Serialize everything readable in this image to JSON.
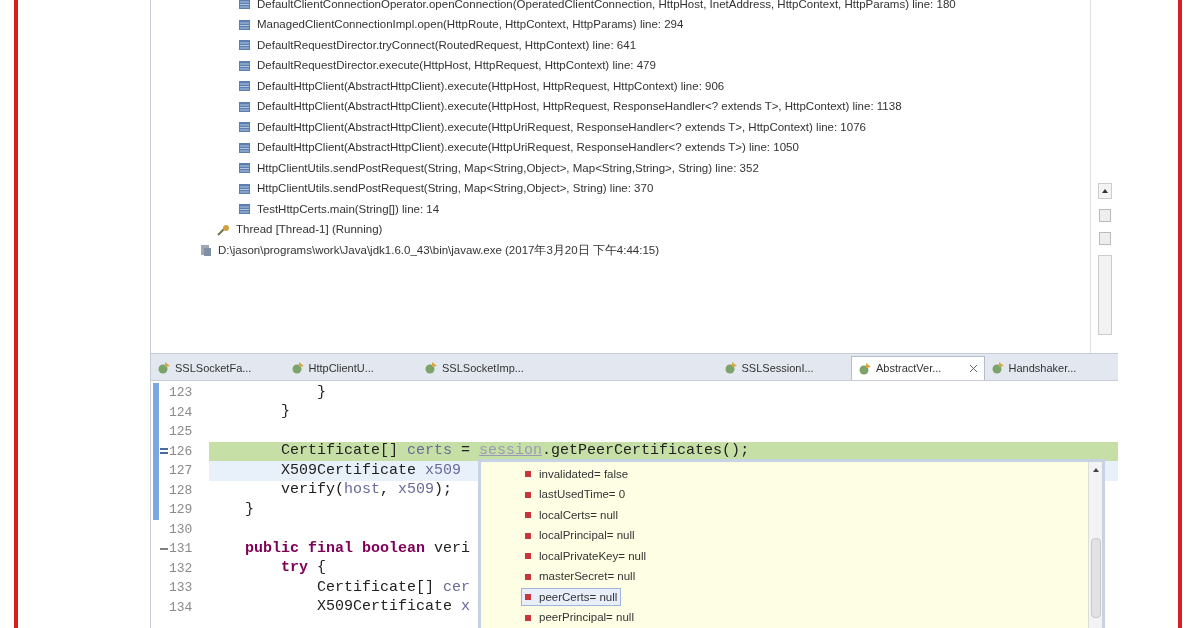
{
  "debug_view": {
    "frames": [
      {
        "label": "DefaultClientConnectionOperator.openConnection(OperatedClientConnection, HttpHost, InetAddress, HttpContext, HttpParams) line: 180"
      },
      {
        "label": "ManagedClientConnectionImpl.open(HttpRoute, HttpContext, HttpParams) line: 294"
      },
      {
        "label": "DefaultRequestDirector.tryConnect(RoutedRequest, HttpContext) line: 641"
      },
      {
        "label": "DefaultRequestDirector.execute(HttpHost, HttpRequest, HttpContext) line: 479"
      },
      {
        "label": "DefaultHttpClient(AbstractHttpClient).execute(HttpHost, HttpRequest, HttpContext) line: 906"
      },
      {
        "label": "DefaultHttpClient(AbstractHttpClient).execute(HttpHost, HttpRequest, ResponseHandler<? extends T>, HttpContext) line: 1138"
      },
      {
        "label": "DefaultHttpClient(AbstractHttpClient).execute(HttpUriRequest, ResponseHandler<? extends T>, HttpContext) line: 1076"
      },
      {
        "label": "DefaultHttpClient(AbstractHttpClient).execute(HttpUriRequest, ResponseHandler<? extends T>) line: 1050"
      },
      {
        "label": "HttpClientUtils.sendPostRequest(String, Map<String,Object>, Map<String,String>, String) line: 352"
      },
      {
        "label": "HttpClientUtils.sendPostRequest(String, Map<String,Object>, String) line: 370"
      },
      {
        "label": "TestHttpCerts.main(String[]) line: 14"
      }
    ],
    "thread": {
      "label": "Thread [Thread-1] (Running)"
    },
    "process": {
      "label": "D:\\jason\\programs\\work\\Java\\jdk1.6.0_43\\bin\\javaw.exe (2017年3月20日 下午4:44:15)"
    }
  },
  "editor_tabs": [
    {
      "label": "SSLSocketFa...",
      "selected": false
    },
    {
      "label": "HttpClientU...",
      "selected": false
    },
    {
      "label": "SSLSocketImp...",
      "selected": false
    },
    {
      "label": "SSLSessionI...",
      "selected": false
    },
    {
      "label": "AbstractVer...",
      "selected": true
    },
    {
      "label": "Handshaker...",
      "selected": false
    }
  ],
  "code_lines": [
    {
      "number": "123",
      "marked": true,
      "current": false,
      "cursor": false,
      "pointer": false,
      "fold": false,
      "tokens": [
        {
          "text": "            }",
          "kind": "plain"
        }
      ]
    },
    {
      "number": "124",
      "marked": true,
      "current": false,
      "cursor": false,
      "pointer": false,
      "fold": false,
      "tokens": [
        {
          "text": "        }",
          "kind": "plain"
        }
      ]
    },
    {
      "number": "125",
      "marked": true,
      "current": false,
      "cursor": false,
      "pointer": false,
      "fold": false
    },
    {
      "number": "126",
      "marked": true,
      "current": true,
      "cursor": false,
      "pointer": true,
      "fold": false,
      "tokens": [
        {
          "text": "        Certificate[] ",
          "kind": "plain"
        },
        {
          "text": "certs",
          "kind": "local"
        },
        {
          "text": " = ",
          "kind": "plain"
        },
        {
          "text": "session",
          "kind": "field"
        },
        {
          "text": ".getPeerCertificates();",
          "kind": "plain"
        }
      ]
    },
    {
      "number": "127",
      "marked": true,
      "current": false,
      "cursor": true,
      "pointer": false,
      "fold": false,
      "tokens": [
        {
          "text": "        X509Certificate ",
          "kind": "plain"
        },
        {
          "text": "x509",
          "kind": "local"
        }
      ]
    },
    {
      "number": "128",
      "marked": true,
      "current": false,
      "cursor": false,
      "pointer": false,
      "fold": false,
      "tokens": [
        {
          "text": "        verify(",
          "kind": "plain"
        },
        {
          "text": "host",
          "kind": "local"
        },
        {
          "text": ", ",
          "kind": "plain"
        },
        {
          "text": "x509",
          "kind": "local"
        },
        {
          "text": ");",
          "kind": "plain"
        }
      ]
    },
    {
      "number": "129",
      "marked": true,
      "current": false,
      "cursor": false,
      "pointer": false,
      "fold": false,
      "tokens": [
        {
          "text": "    }",
          "kind": "plain"
        }
      ]
    },
    {
      "number": "130",
      "marked": false,
      "current": false,
      "cursor": false,
      "pointer": false,
      "fold": false
    },
    {
      "number": "131",
      "marked": false,
      "current": false,
      "cursor": false,
      "pointer": false,
      "fold": true,
      "tokens": [
        {
          "text": "    public final boolean",
          "kind": "keyword"
        },
        {
          "text": " veri",
          "kind": "plain"
        }
      ]
    },
    {
      "number": "132",
      "marked": false,
      "current": false,
      "cursor": false,
      "pointer": false,
      "fold": false,
      "tokens": [
        {
          "text": "        try",
          "kind": "keyword"
        },
        {
          "text": " {",
          "kind": "plain"
        }
      ]
    },
    {
      "number": "133",
      "marked": false,
      "current": false,
      "cursor": false,
      "pointer": false,
      "fold": false,
      "tokens": [
        {
          "text": "            Certificate[] ",
          "kind": "plain"
        },
        {
          "text": "cer",
          "kind": "local"
        }
      ]
    },
    {
      "number": "134",
      "marked": false,
      "current": false,
      "cursor": false,
      "pointer": false,
      "fold": false,
      "tokens": [
        {
          "text": "            X509Certificate ",
          "kind": "plain"
        },
        {
          "text": "x",
          "kind": "local"
        }
      ]
    }
  ],
  "hover_popup": {
    "fields": [
      {
        "label": "invalidated= false",
        "selected": false
      },
      {
        "label": "lastUsedTime= 0",
        "selected": false
      },
      {
        "label": "localCerts= null",
        "selected": false
      },
      {
        "label": "localPrincipal= null",
        "selected": false
      },
      {
        "label": "localPrivateKey= null",
        "selected": false
      },
      {
        "label": "masterSecret= null",
        "selected": false
      },
      {
        "label": "peerCerts= null",
        "selected": true
      },
      {
        "label": "peerPrincipal= null",
        "selected": false
      }
    ]
  }
}
